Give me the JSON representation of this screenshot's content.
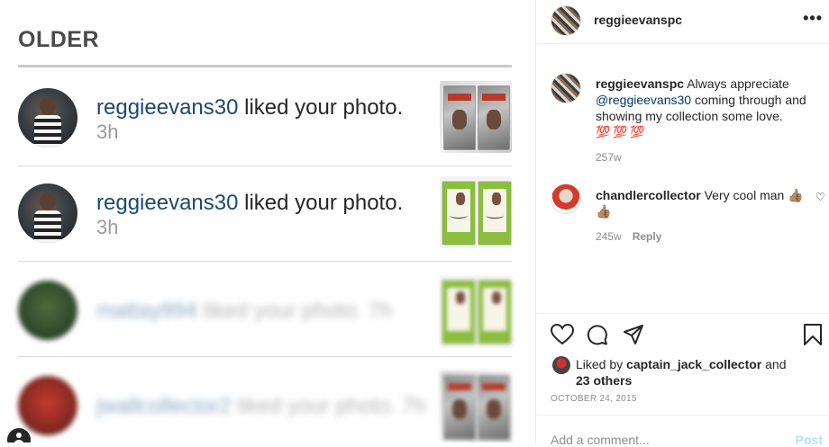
{
  "left_panel": {
    "section_title": "OLDER",
    "notifications": [
      {
        "username": "reggieevans30",
        "action": "liked your photo.",
        "time": "3h",
        "blurred": false
      },
      {
        "username": "reggieevans30",
        "action": "liked your photo.",
        "time": "3h",
        "blurred": false
      },
      {
        "username": "mattay994",
        "action": "liked your photo.",
        "time": "7h",
        "blurred": true
      },
      {
        "username": "jwallcollector2",
        "action": "liked your photo.",
        "time": "7h",
        "blurred": true
      }
    ]
  },
  "post_panel": {
    "header": {
      "username": "reggieevanspc",
      "more_icon": "more-horizontal-icon"
    },
    "caption": {
      "username": "reggieevanspc",
      "text_before": "Always appreciate",
      "mention": "@reggieevans30",
      "text_after": "coming through and showing my collection some love.",
      "emojis": "💯💯💯",
      "age": "257w"
    },
    "comments": [
      {
        "username": "chandlercollector",
        "text": "Very cool man 👍🏽 👍🏽",
        "age": "245w",
        "reply_label": "Reply"
      }
    ],
    "likes": {
      "prefix": "Liked by",
      "user": "captain_jack_collector",
      "suffix": "and",
      "others": "23 others"
    },
    "date": "OCTOBER 24, 2015",
    "add_comment_placeholder": "Add a comment...",
    "post_label": "Post"
  }
}
